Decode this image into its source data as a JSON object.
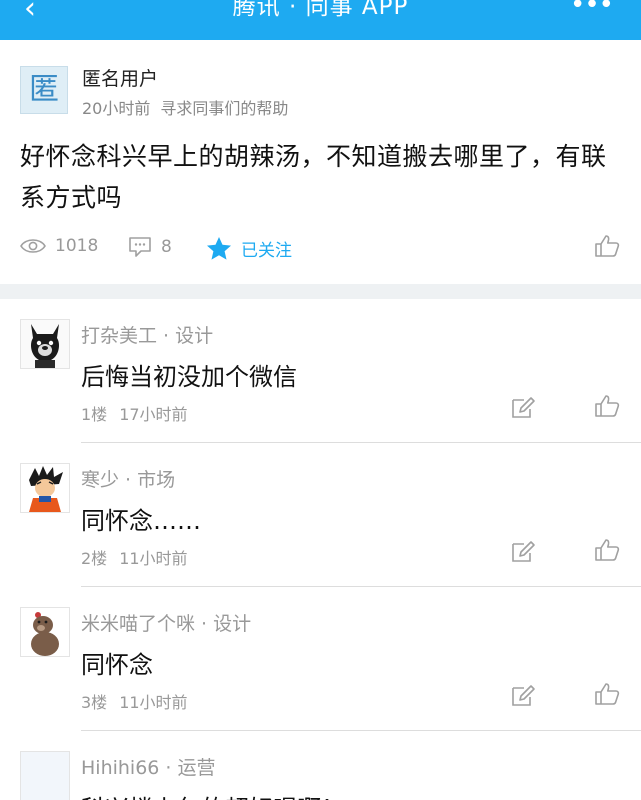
{
  "header": {
    "back_icon": "chevron-left-icon",
    "back_glyph": "‹",
    "title": "腾讯 · 同事 APP",
    "more_glyph": "•••",
    "color": "#1eaaf1"
  },
  "post": {
    "avatar_char": "匿",
    "author": "匿名用户",
    "time": "20小时前",
    "category": "寻求同事们的帮助",
    "content": "好怀念科兴早上的胡辣汤，不知道搬去哪里了，有联系方式吗",
    "views": "1018",
    "comments": "8",
    "follow_label": "已关注"
  },
  "comments": [
    {
      "name": "打杂美工 · 设计",
      "text": "后悔当初没加个微信",
      "floor": "1楼",
      "time": "17小时前",
      "avatar_icon": "bulldog-avatar-icon"
    },
    {
      "name": "寒少 · 市场",
      "text": "同怀念……",
      "floor": "2楼",
      "time": "11小时前",
      "avatar_icon": "goku-avatar-icon"
    },
    {
      "name": "米米喵了个咪 · 设计",
      "text": "同怀念",
      "floor": "3楼",
      "time": "11小时前",
      "avatar_icon": "bear-avatar-icon"
    },
    {
      "name": "Hihihi66 · 运营",
      "text": "科兴楼上包的超好喝啊！",
      "avatar_icon": "blank-avatar-icon"
    }
  ]
}
